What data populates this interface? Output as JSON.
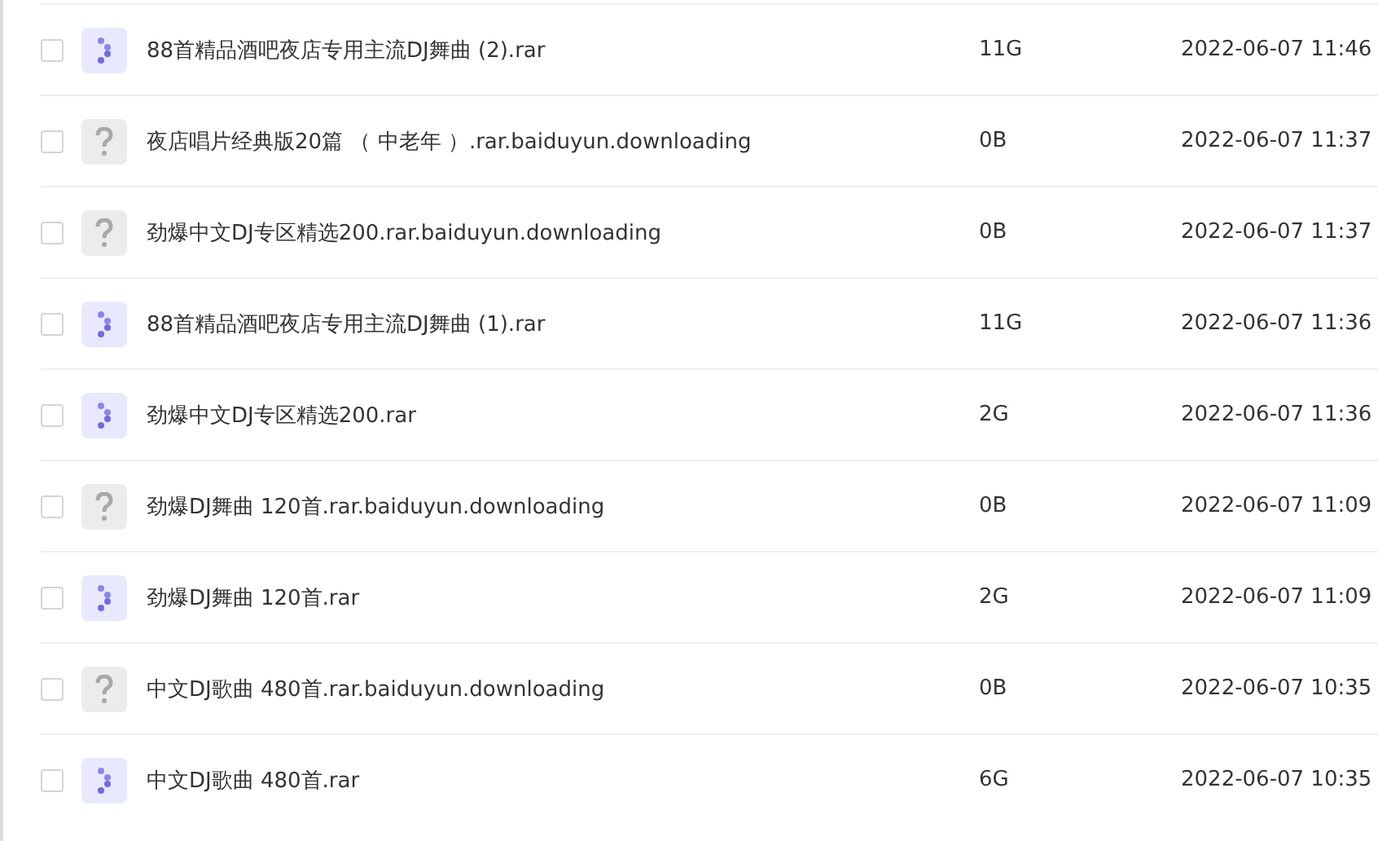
{
  "files": [
    {
      "kind": "archive",
      "checked": false,
      "name": "88首精品酒吧夜店专用主流DJ舞曲 (2).rar",
      "size": "11G",
      "modified": "2022-06-07 11:46"
    },
    {
      "kind": "unknown",
      "checked": false,
      "name": "夜店唱片经典版20篇 （ 中老年 ）.rar.baiduyun.downloading",
      "size": "0B",
      "modified": "2022-06-07 11:37"
    },
    {
      "kind": "unknown",
      "checked": false,
      "name": "劲爆中文DJ专区精选200.rar.baiduyun.downloading",
      "size": "0B",
      "modified": "2022-06-07 11:37"
    },
    {
      "kind": "archive",
      "checked": false,
      "name": "88首精品酒吧夜店专用主流DJ舞曲 (1).rar",
      "size": "11G",
      "modified": "2022-06-07 11:36"
    },
    {
      "kind": "archive",
      "checked": false,
      "name": "劲爆中文DJ专区精选200.rar",
      "size": "2G",
      "modified": "2022-06-07 11:36"
    },
    {
      "kind": "unknown",
      "checked": false,
      "name": "劲爆DJ舞曲 120首.rar.baiduyun.downloading",
      "size": "0B",
      "modified": "2022-06-07 11:09"
    },
    {
      "kind": "archive",
      "checked": false,
      "name": "劲爆DJ舞曲 120首.rar",
      "size": "2G",
      "modified": "2022-06-07 11:09"
    },
    {
      "kind": "unknown",
      "checked": false,
      "name": "中文DJ歌曲 480首.rar.baiduyun.downloading",
      "size": "0B",
      "modified": "2022-06-07 10:35"
    },
    {
      "kind": "archive",
      "checked": false,
      "name": "中文DJ歌曲 480首.rar",
      "size": "6G",
      "modified": "2022-06-07 10:35"
    }
  ]
}
